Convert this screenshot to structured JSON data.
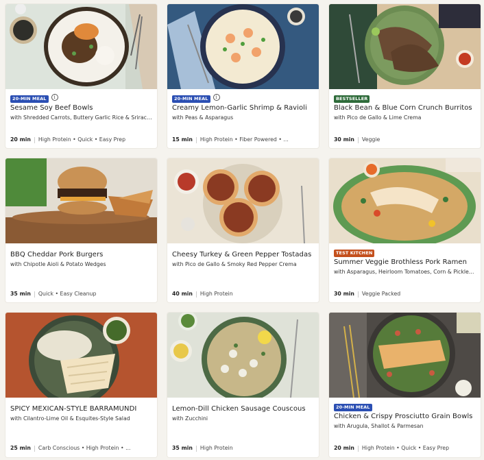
{
  "cards": [
    {
      "tag": "20-MIN MEAL",
      "tag_color": "blue",
      "info": true,
      "title": "Sesame Soy Beef Bowls",
      "subtitle": "with Shredded Carrots, Buttery Garlic Rice & Sriracha Mayo",
      "time": "20 min",
      "labels": "High Protein • Quick • Easy Prep"
    },
    {
      "tag": "20-MIN MEAL",
      "tag_color": "blue",
      "info": true,
      "title": "Creamy Lemon-Garlic Shrimp & Ravioli",
      "subtitle": "with Peas & Asparagus",
      "time": "15 min",
      "labels": "High Protein • Fiber Powered • ..."
    },
    {
      "tag": "BESTSELLER",
      "tag_color": "green",
      "info": false,
      "title": "Black Bean & Blue Corn Crunch Burritos",
      "subtitle": "with Pico de Gallo & Lime Crema",
      "time": "30 min",
      "labels": "Veggie"
    },
    {
      "tag": "",
      "tag_color": "",
      "info": false,
      "title": "BBQ Cheddar Pork Burgers",
      "subtitle": "with Chipotle Aioli & Potato Wedges",
      "time": "35 min",
      "labels": "Quick • Easy Cleanup"
    },
    {
      "tag": "",
      "tag_color": "",
      "info": false,
      "title": "Cheesy Turkey & Green Pepper Tostadas",
      "subtitle": "with Pico de Gallo & Smoky Red Pepper Crema",
      "time": "40 min",
      "labels": "High Protein"
    },
    {
      "tag": "TEST KITCHEN",
      "tag_color": "orange",
      "info": false,
      "title": "Summer Veggie Brothless Pork Ramen",
      "subtitle": "with Asparagus, Heirloom Tomatoes, Corn & Pickled Shallot",
      "time": "30 min",
      "labels": "Veggie Packed"
    },
    {
      "tag": "",
      "tag_color": "",
      "info": false,
      "title": "SPICY MEXICAN-STYLE BARRAMUNDI",
      "subtitle": "with Cilantro-Lime Oil & Esquites-Style Salad",
      "time": "25 min",
      "labels": "Carb Conscious • High Protein • ..."
    },
    {
      "tag": "",
      "tag_color": "",
      "info": false,
      "title": "Lemon-Dill Chicken Sausage Couscous",
      "subtitle": "with Zucchini",
      "time": "35 min",
      "labels": "High Protein"
    },
    {
      "tag": "20-MIN MEAL",
      "tag_color": "blue",
      "info": false,
      "title": "Chicken & Crispy Prosciutto Grain Bowls",
      "subtitle": "with Arugula, Shallot & Parmesan",
      "time": "20 min",
      "labels": "High Protein • Quick • Easy Prep"
    }
  ]
}
